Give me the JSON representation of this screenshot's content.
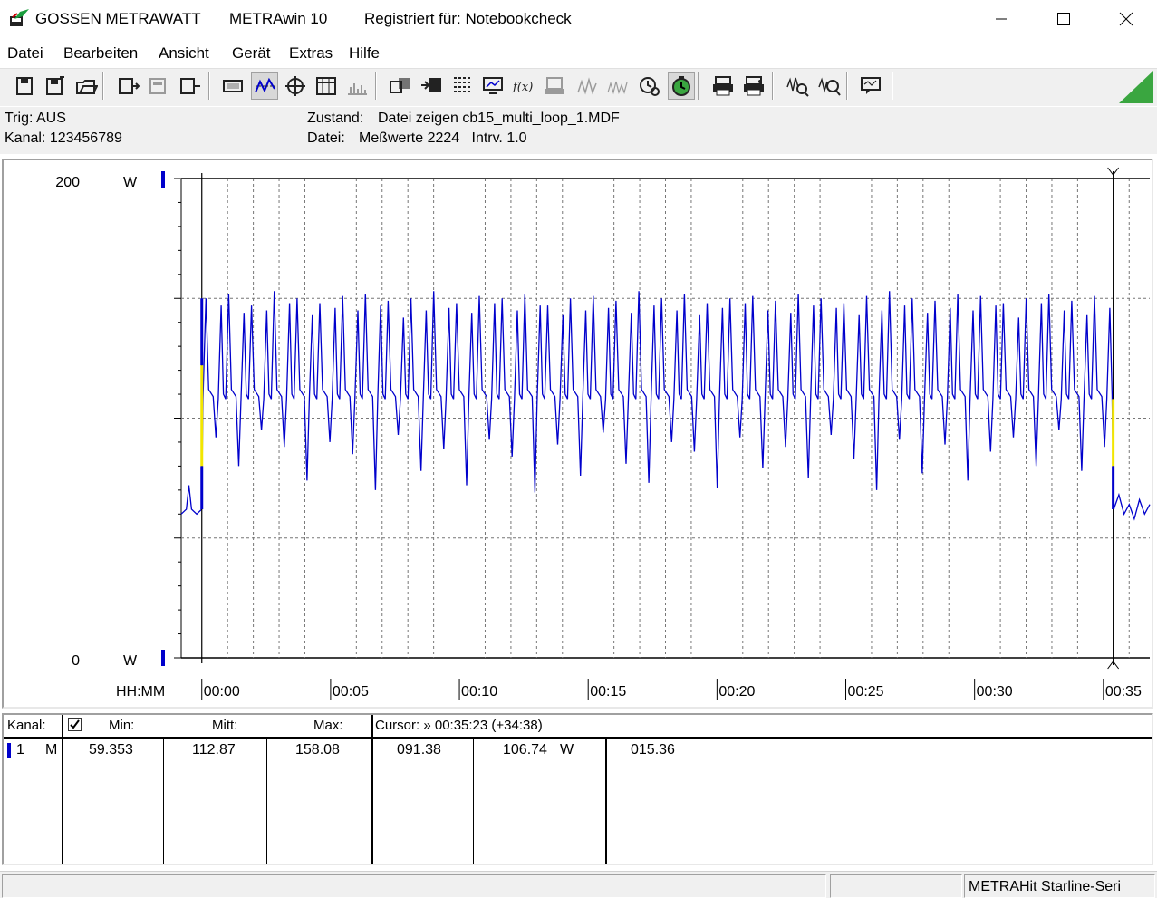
{
  "window": {
    "brand": "GOSSEN METRAWATT",
    "app_name": "METRAwin 10",
    "registration": "Registriert für: Notebookcheck"
  },
  "menu": [
    "Datei",
    "Bearbeiten",
    "Ansicht",
    "Gerät",
    "Extras",
    "Hilfe"
  ],
  "toolbar_icons": [
    "save-file-icon",
    "save-as-icon",
    "open-folder-icon",
    "device-import-icon",
    "device-config-icon",
    "device-export-icon",
    "display-icon",
    "chart-view-icon",
    "crosshair-icon",
    "table-view-icon",
    "histogram-icon",
    "export-icon",
    "transfer-icon",
    "data-list-icon",
    "computer-icon",
    "function-icon",
    "printer-device-icon",
    "wave-icon",
    "signal-icon",
    "clock-search-icon",
    "stopwatch-icon",
    "print-icon",
    "print-preview-icon",
    "zoom-wave-icon",
    "search-wave-icon",
    "comment-icon"
  ],
  "info": {
    "trig": "Trig: AUS",
    "kanal": "Kanal: 123456789",
    "zustand_label": "Zustand:",
    "zustand_value": "Datei zeigen cb15_multi_loop_1.MDF",
    "datei_label": "Datei:",
    "datei_value": "Meßwerte 2224   Intrv. 1.0"
  },
  "chart_data": {
    "type": "line",
    "ymax_label": "200",
    "ymin_label": "0",
    "y_unit": "W",
    "ylim": [
      0,
      200
    ],
    "x_axis_label": "HH:MM",
    "x_ticks": [
      "00:00",
      "00:05",
      "00:10",
      "00:15",
      "00:20",
      "00:25",
      "00:30",
      "00:35"
    ],
    "x_range_minutes": [
      -0.8,
      36.8
    ],
    "cursor_left_minutes": 0.0,
    "cursor_right_minutes": 35.38,
    "grid": true,
    "series": [
      {
        "color": "#0000cc",
        "idle_before": [
          [
            -0.8,
            60
          ],
          [
            -0.6,
            62
          ],
          [
            -0.5,
            72
          ],
          [
            -0.4,
            62
          ],
          [
            -0.2,
            60
          ],
          [
            0.0,
            62
          ]
        ],
        "load_baseline": 108,
        "load_peaks": [
          150,
          152,
          147,
          153,
          150,
          148,
          151,
          152,
          149,
          150,
          153,
          148,
          151,
          150,
          152,
          147,
          150,
          151,
          149,
          153,
          150,
          152,
          148,
          150,
          151,
          149,
          152,
          150,
          148,
          151,
          153,
          150,
          149,
          152,
          151,
          148,
          150,
          152,
          149,
          151
        ],
        "load_dips": [
          92,
          80,
          95,
          88,
          74,
          90,
          85,
          70,
          93,
          78,
          87,
          72,
          91,
          84,
          69,
          89,
          76,
          94,
          81,
          73,
          90,
          86,
          71,
          92,
          79,
          88,
          75,
          93,
          83,
          70,
          91,
          77,
          89,
          74,
          86,
          92,
          80,
          95,
          78,
          88
        ],
        "load_start_minutes": 0.0,
        "load_end_minutes": 35.38,
        "idle_after": [
          [
            35.4,
            62
          ],
          [
            35.6,
            68
          ],
          [
            35.8,
            60
          ],
          [
            36.0,
            64
          ],
          [
            36.2,
            58
          ],
          [
            36.4,
            66
          ],
          [
            36.6,
            60
          ],
          [
            36.8,
            64
          ]
        ]
      }
    ]
  },
  "table": {
    "headers": {
      "kanal": "Kanal:",
      "min": "Min:",
      "mitt": "Mitt:",
      "max": "Max:",
      "cursor": "Cursor: » 00:35:23 (+34:38)"
    },
    "row": {
      "channel": "1",
      "mode": "M",
      "min": "59.353",
      "mitt": "112.87",
      "max": "158.08",
      "cursor_a": "091.38",
      "cursor_b": "106.74",
      "unit": "W",
      "diff": "015.36"
    }
  },
  "status": {
    "device": "METRAHit Starline-Seri"
  }
}
